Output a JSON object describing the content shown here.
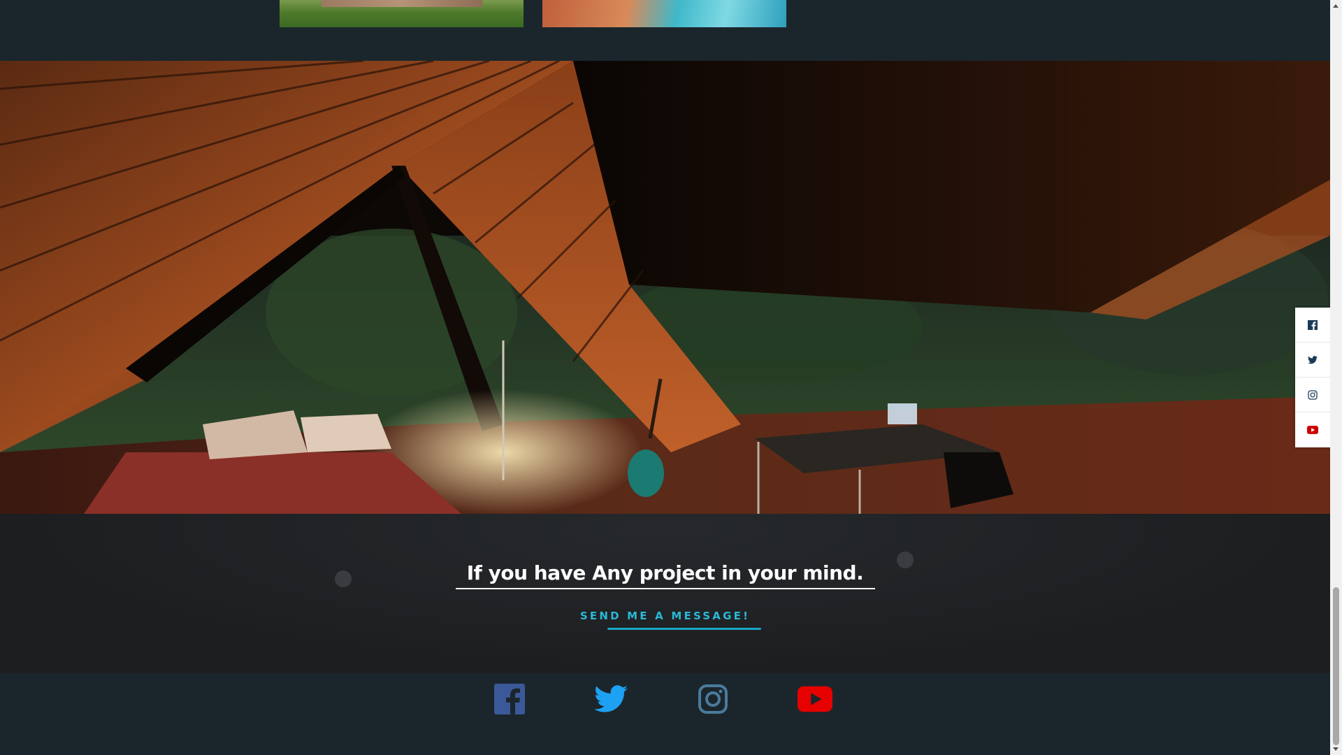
{
  "gallery": {
    "items": [
      {
        "name": "garden-thumbnail"
      },
      {
        "name": "pool-thumbnail"
      }
    ]
  },
  "hero": {
    "image": "attic-bedroom-interior"
  },
  "cta": {
    "heading": "If you have Any project in your mind.",
    "button_label": "SEND ME A MESSAGE!",
    "accent_color": "#2ab9d6"
  },
  "footer": {
    "social": [
      {
        "icon": "facebook-icon",
        "color": "#3b5998"
      },
      {
        "icon": "twitter-icon",
        "color": "#1da1f2"
      },
      {
        "icon": "instagram-icon",
        "color": "#4b7b9c"
      },
      {
        "icon": "youtube-icon",
        "color": "#e60000"
      }
    ]
  },
  "sidebar": {
    "buttons": [
      {
        "icon": "facebook-icon"
      },
      {
        "icon": "twitter-icon"
      },
      {
        "icon": "instagram-icon"
      },
      {
        "icon": "youtube-icon"
      }
    ]
  }
}
